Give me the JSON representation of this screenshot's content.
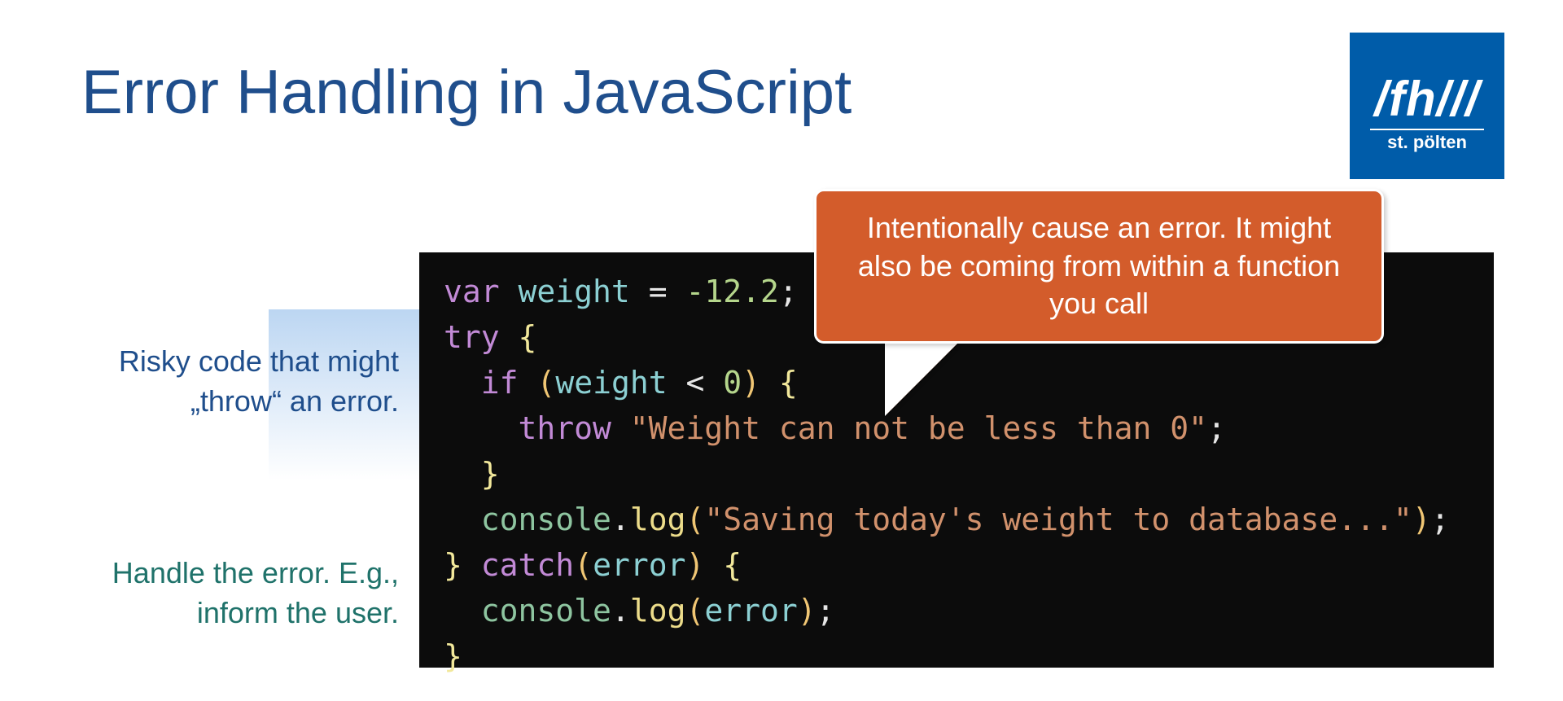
{
  "title": "Error Handling in JavaScript",
  "logo": {
    "main": "/fh///",
    "sub": "st. pölten"
  },
  "sideLabels": {
    "risky": "Risky code that might „throw“ an error.",
    "handle": "Handle the error. E.g., inform the user."
  },
  "callout": "Intentionally cause an error. It might also be coming from within a function you call",
  "code": {
    "varKw": "var",
    "weight": "weight",
    "eq": " = ",
    "num": "-12.2",
    "semi": ";",
    "tryKw": "try",
    "ifKw": "if",
    "lt": " < ",
    "zero": "0",
    "throwKw": "throw",
    "throwStr": "\"Weight can not be less than 0\"",
    "console": "console",
    "dot": ".",
    "log": "log",
    "logStr": "\"Saving today's weight to database...\"",
    "catchKw": "catch",
    "error": "error"
  }
}
